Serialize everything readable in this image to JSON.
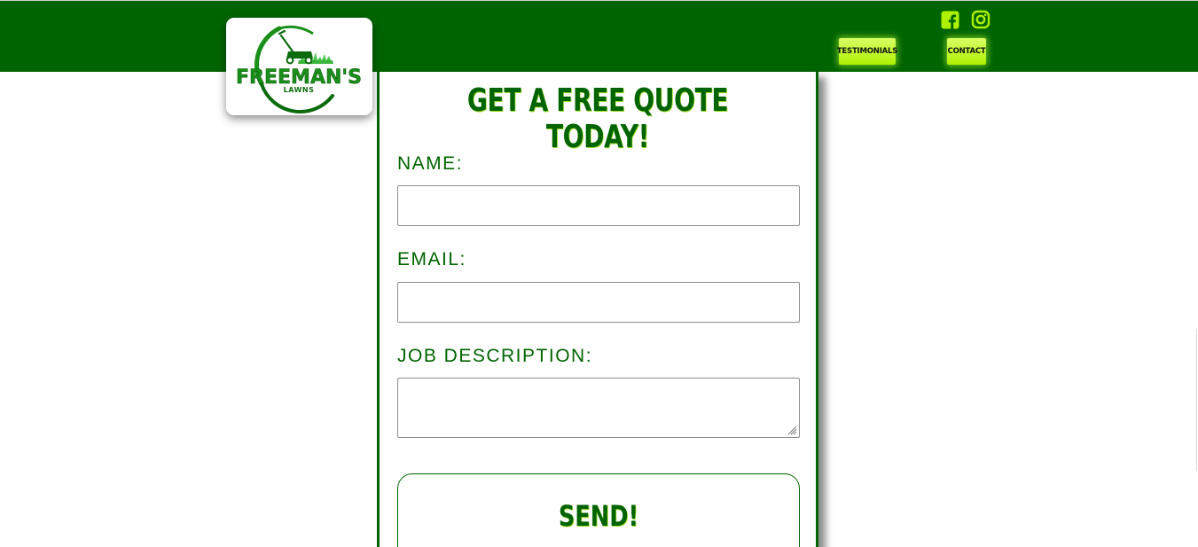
{
  "brand": {
    "logo_primary": "FREEMAN'S",
    "logo_secondary": "LAWNS"
  },
  "colors": {
    "header_bg": "#006400",
    "accent": "#ADF000",
    "text_green": "#006400"
  },
  "social": [
    {
      "icon": "facebook-icon"
    },
    {
      "icon": "instagram-icon"
    }
  ],
  "nav": {
    "testimonials_label": "TESTIMONIALS",
    "contact_label": "CONTACT"
  },
  "form": {
    "title": "GET A FREE QUOTE TODAY!",
    "name_label": "NAME:",
    "name_value": "",
    "email_label": "EMAIL:",
    "email_value": "",
    "job_label": "JOB DESCRIPTION:",
    "job_value": "",
    "submit_label": "SEND!"
  }
}
